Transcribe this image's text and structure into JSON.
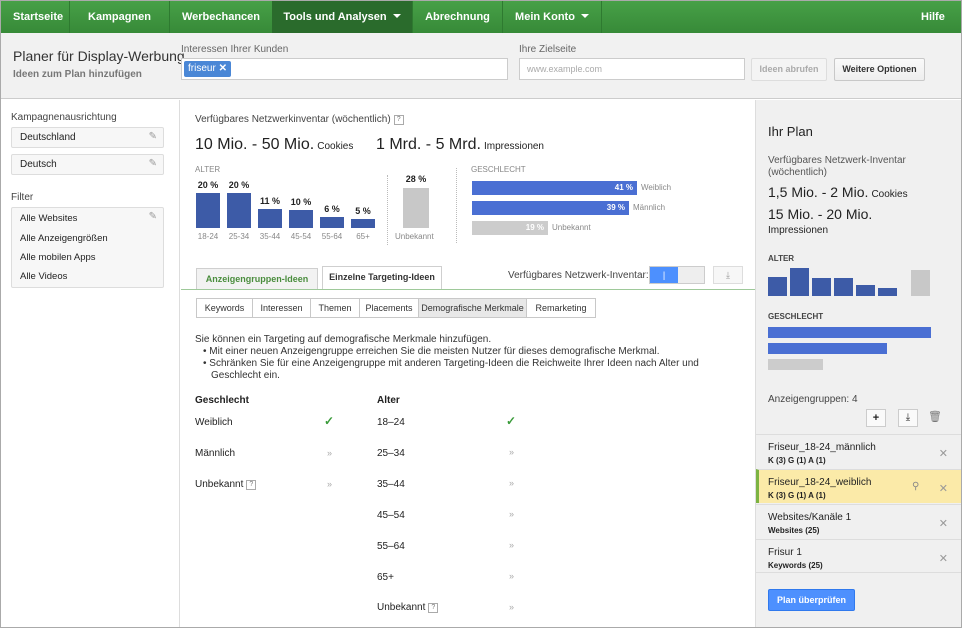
{
  "nav": {
    "items": [
      "Startseite",
      "Kampagnen",
      "Werbechancen",
      "Tools und Analysen",
      "Abrechnung",
      "Mein Konto"
    ],
    "help": "Hilfe"
  },
  "header": {
    "title": "Planer für Display-Werbung",
    "subtitle": "Ideen zum Plan hinzufügen",
    "interests_label": "Interessen Ihrer Kunden",
    "interest_chip": "friseur",
    "landing_label": "Ihre Zielseite",
    "landing_placeholder": "www.example.com",
    "get_ideas": "Ideen abrufen",
    "more_options": "Weitere Optionen"
  },
  "left": {
    "targeting_label": "Kampagnenausrichtung",
    "location": "Deutschland",
    "language": "Deutsch",
    "filter_label": "Filter",
    "filters": [
      "Alle Websites",
      "Alle Anzeigengrößen",
      "Alle mobilen Apps",
      "Alle Videos"
    ]
  },
  "inventory": {
    "title": "Verfügbares Netzwerkinventar (wöchentlich)",
    "cookies_value": "10 Mio. - 50 Mio.",
    "cookies_unit": "Cookies",
    "impr_value": "1 Mrd. - 5 Mrd.",
    "impr_unit": "Impressionen",
    "age_label": "ALTER",
    "ages": [
      {
        "label": "18-24",
        "pct": "20 %",
        "value": 20
      },
      {
        "label": "25-34",
        "pct": "20 %",
        "value": 20
      },
      {
        "label": "35-44",
        "pct": "11 %",
        "value": 11
      },
      {
        "label": "45-54",
        "pct": "10 %",
        "value": 10
      },
      {
        "label": "55-64",
        "pct": "6 %",
        "value": 6
      },
      {
        "label": "65+",
        "pct": "5 %",
        "value": 5
      }
    ],
    "unknown_pct": "28 %",
    "unknown_value": 28,
    "unknown_label": "Unbekannt",
    "gender_label": "GESCHLECHT",
    "genders": [
      {
        "pct": "41 %",
        "label": "Weiblich",
        "value": 41
      },
      {
        "pct": "39 %",
        "label": "Männlich",
        "value": 39
      },
      {
        "pct": "19 %",
        "label": "Unbekannt",
        "value": 19
      }
    ]
  },
  "tabs": {
    "adgroup": "Anzeigengruppen-Ideen",
    "targeting": "Einzelne Targeting-Ideen",
    "inventory_label": "Verfügbares Netzwerk-Inventar:"
  },
  "subtabs": [
    "Keywords",
    "Interessen",
    "Themen",
    "Placements",
    "Demografische Merkmale",
    "Remarketing"
  ],
  "demo": {
    "intro": "Sie können ein Targeting auf demografische Merkmale hinzufügen.",
    "bullet1": "Mit einer neuen Anzeigengruppe erreichen Sie die meisten Nutzer für dieses demografische Merkmal.",
    "bullet2a": "Schränken Sie für eine Anzeigengruppe mit anderen Targeting-Ideen die Reichweite Ihrer Ideen nach Alter und",
    "bullet2b": "Geschlecht ein.",
    "gender_head": "Geschlecht",
    "genders": [
      "Weiblich",
      "Männlich",
      "Unbekannt"
    ],
    "age_head": "Alter",
    "ages": [
      "18–24",
      "25–34",
      "35–44",
      "45–54",
      "55–64",
      "65+",
      "Unbekannt"
    ]
  },
  "plan": {
    "title": "Ihr Plan",
    "inv_title": "Verfügbares Netzwerk-Inventar (wöchentlich)",
    "cookies_value": "1,5 Mio. - 2 Mio.",
    "cookies_unit": "Cookies",
    "impr_value": "15 Mio. - 20 Mio.",
    "impr_unit": "Impressionen",
    "age_label": "ALTER",
    "age_values": [
      22,
      32,
      20,
      20,
      13,
      9
    ],
    "age_unknown": 30,
    "gender_label": "GESCHLECHT",
    "gender_values": [
      100,
      73,
      34
    ],
    "adgroups_label": "Anzeigengruppen: 4",
    "items": [
      {
        "name": "Friseur_18-24_männlich",
        "sub": "K (3) G (1) A (1)"
      },
      {
        "name": "Friseur_18-24_weiblich",
        "sub": "K (3) G (1) A (1)"
      },
      {
        "name": "Websites/Kanäle 1",
        "sub": "Websites (25)"
      },
      {
        "name": "Frisur 1",
        "sub": "Keywords (25)"
      }
    ],
    "review": "Plan überprüfen"
  },
  "colors": {
    "nav": "#3d8f3f",
    "bar": "#3d5ba7",
    "gender_bar": "#4a6fd3",
    "highlight": "#fbeaa8",
    "accent_btn": "#4d90fe"
  }
}
